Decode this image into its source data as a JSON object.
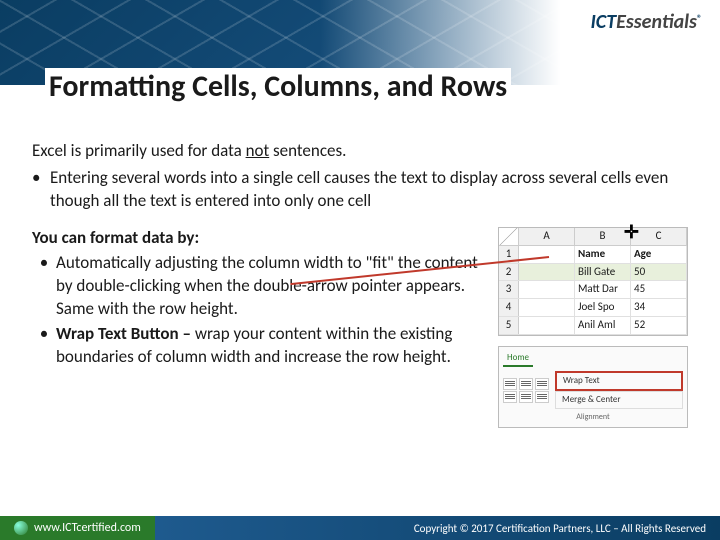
{
  "logo": {
    "part1": "ICT",
    "part2": "Essentials",
    "reg": "®"
  },
  "title": "Formatting Cells, Columns, and Rows",
  "intro": {
    "pre": "Excel is primarily used for data ",
    "not": "not",
    "post": " sentences."
  },
  "bullet1": "Entering several words into a single cell causes the text to display across several cells even though all the text is entered into only one cell",
  "subhead": "You can format data by:",
  "bullet2a": "Automatically adjusting the column width to \"fit\" the content by double-clicking when the double-arrow pointer appears. Same with the row height.",
  "bullet2b_bold": "Wrap Text Button – ",
  "bullet2b_rest": "wrap your content within the existing boundaries of column width and increase the row height.",
  "excel": {
    "cols": [
      "A",
      "B",
      "C"
    ],
    "headers": [
      "",
      "Name",
      "Age"
    ],
    "rows": [
      {
        "n": "2",
        "name": "Bill Gate",
        "age": "50"
      },
      {
        "n": "3",
        "name": "Matt Dar",
        "age": "45"
      },
      {
        "n": "4",
        "name": "Joel Spo",
        "age": "34"
      },
      {
        "n": "5",
        "name": "Anil Aml",
        "age": "52"
      }
    ]
  },
  "ribbon": {
    "tab": "Home",
    "wrap": "Wrap Text",
    "merge": "Merge & Center",
    "group": "Alignment"
  },
  "footer": {
    "url": "www.ICTcertified.com",
    "copyright": "Copyright © 2017 Certification Partners, LLC – All Rights Reserved"
  }
}
